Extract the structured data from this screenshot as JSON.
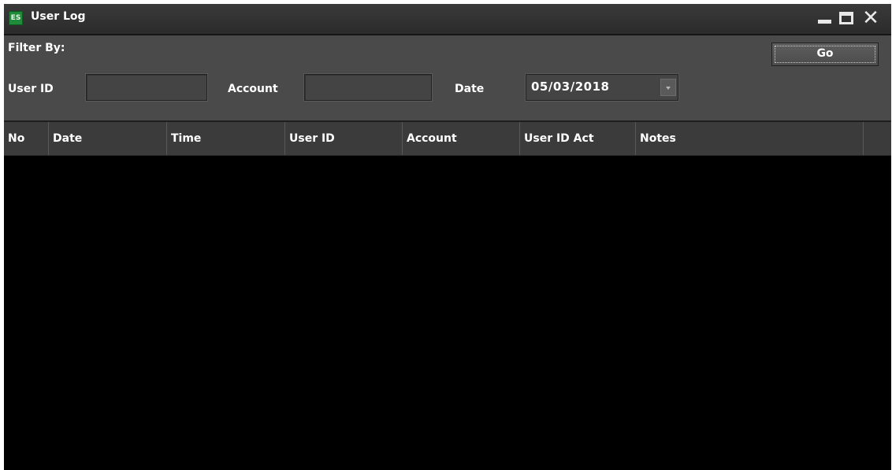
{
  "window": {
    "title": "User Log",
    "app_icon_text": "ES",
    "controls": {
      "minimize": "minimize-icon",
      "maximize": "maximize-icon",
      "close": "✕"
    }
  },
  "filter": {
    "heading": "Filter By:",
    "user_id_label": "User ID",
    "user_id_value": "",
    "account_label": "Account",
    "account_value": "",
    "date_label": "Date",
    "date_value": "05/03/2018",
    "go_label": "Go"
  },
  "table": {
    "columns": [
      "No",
      "Date",
      "Time",
      "User ID",
      "Account",
      "User ID Act",
      "Notes",
      ""
    ],
    "rows": []
  },
  "colors": {
    "titlebar": "#2f2f2f",
    "panel": "#4a4a4a",
    "header": "#3b3b3b",
    "grid": "#000000",
    "accent_icon": "#1f8c3a"
  }
}
